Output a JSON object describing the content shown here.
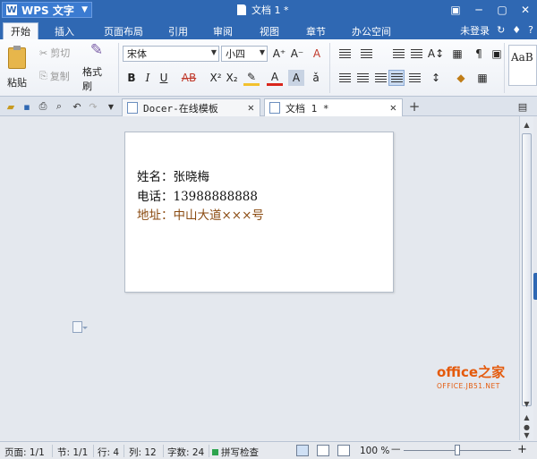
{
  "titlebar": {
    "app_name": "WPS 文字",
    "document_title": "文档 1 *",
    "controls": [
      "▣",
      "─",
      "▢",
      "✕"
    ]
  },
  "menu": {
    "tabs": [
      "开始",
      "插入",
      "页面布局",
      "引用",
      "审阅",
      "视图",
      "章节",
      "办公空间"
    ],
    "active_tab": "开始",
    "login_label": "未登录",
    "help": "?"
  },
  "ribbon": {
    "paste_label": "粘贴",
    "cut_label": "剪切",
    "copy_label": "复制",
    "format_painter_label": "格式刷",
    "font_name": "宋体",
    "font_size": "小四",
    "style_preview": "AaB"
  },
  "doc_tabs": [
    {
      "label": "Docer-在线模板"
    },
    {
      "label": "文档 1 *"
    }
  ],
  "document": {
    "line1": "姓名：张晓梅",
    "line2": "电话：13988888888",
    "line3": "地址：中山大道×××号"
  },
  "watermark": {
    "main": "office之家",
    "sub": "OFFICE.JB51.NET"
  },
  "status": {
    "page": "页面: 1/1",
    "section": "节: 1/1",
    "row": "行: 4",
    "column": "列: 12",
    "word_count": "字数: 24",
    "spellcheck": "拼写检查",
    "zoom": "100 %",
    "zoom_minus": "—",
    "zoom_plus": "+"
  },
  "colors": {
    "titlebar": "#2f68b3",
    "address_text": "#8a4a10",
    "watermark": "#e45a0c"
  }
}
